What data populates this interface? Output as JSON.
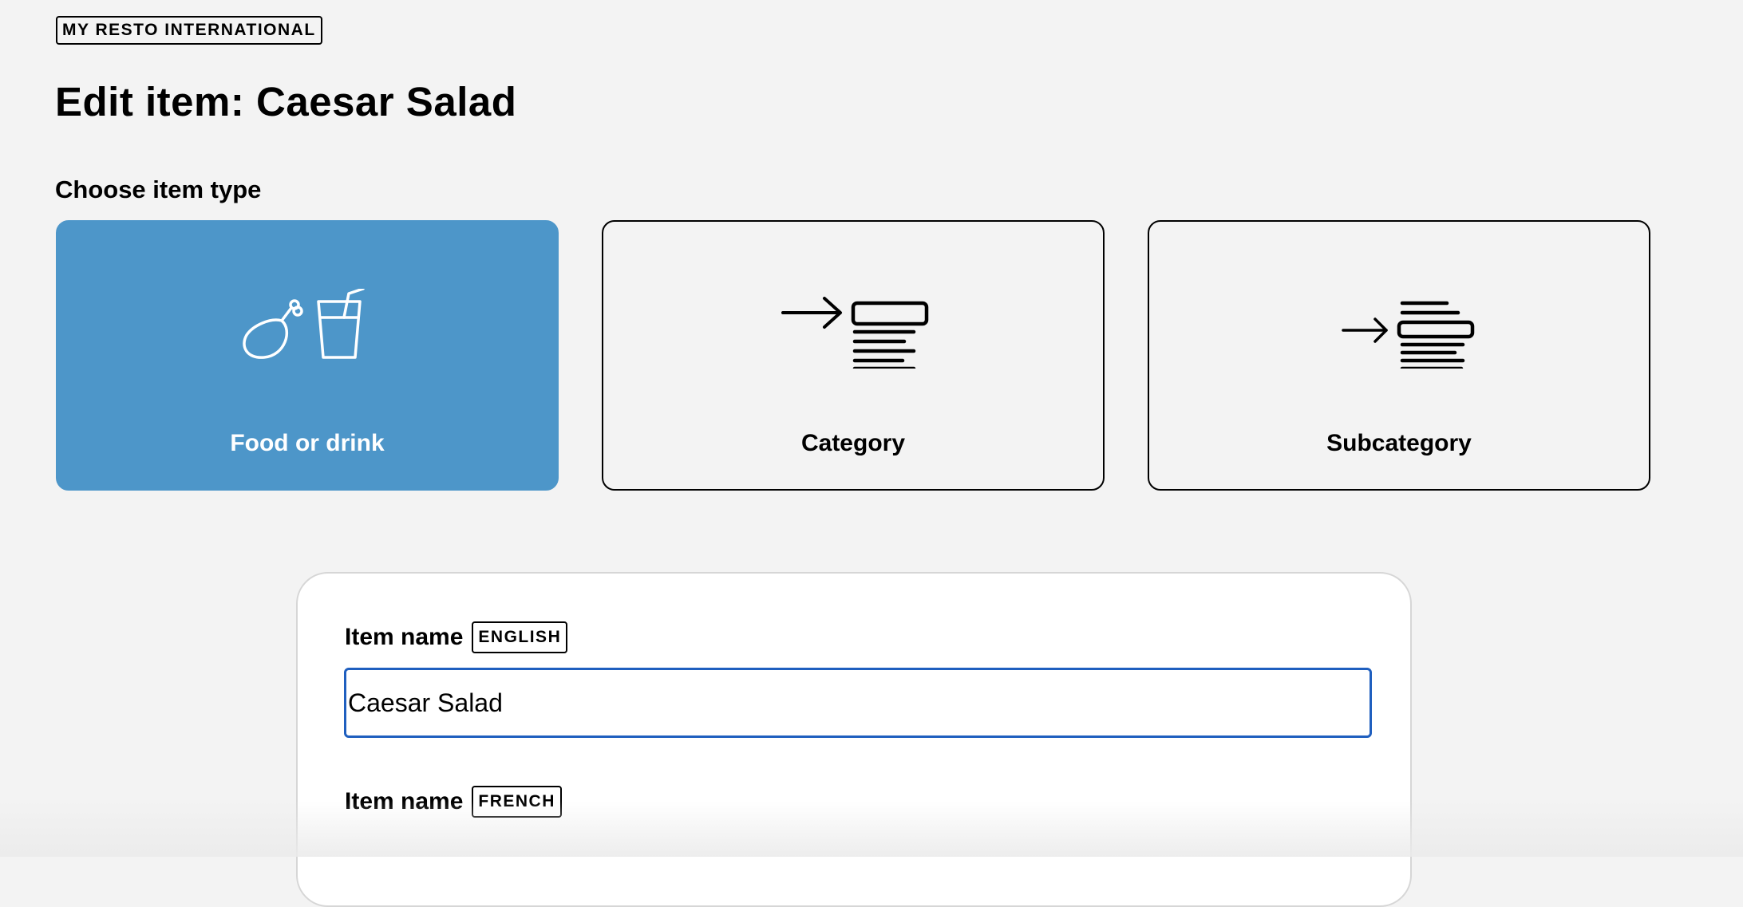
{
  "brand": {
    "name": "MY RESTO INTERNATIONAL"
  },
  "page": {
    "title": "Edit item: Caesar Salad"
  },
  "item_type": {
    "label": "Choose item type",
    "selected": "Food or drink",
    "options": [
      {
        "label": "Food or drink",
        "icon": "food-drink-icon"
      },
      {
        "label": "Category",
        "icon": "category-icon"
      },
      {
        "label": "Subcategory",
        "icon": "subcategory-icon"
      }
    ]
  },
  "form": {
    "name_en": {
      "label": "Item name",
      "lang": "ENGLISH",
      "value": "Caesar Salad"
    },
    "name_fr": {
      "label": "Item name",
      "lang": "FRENCH"
    }
  },
  "colors": {
    "accent": "#4d96c9",
    "focus_border": "#1f5fbf",
    "background": "#f3f3f3"
  }
}
